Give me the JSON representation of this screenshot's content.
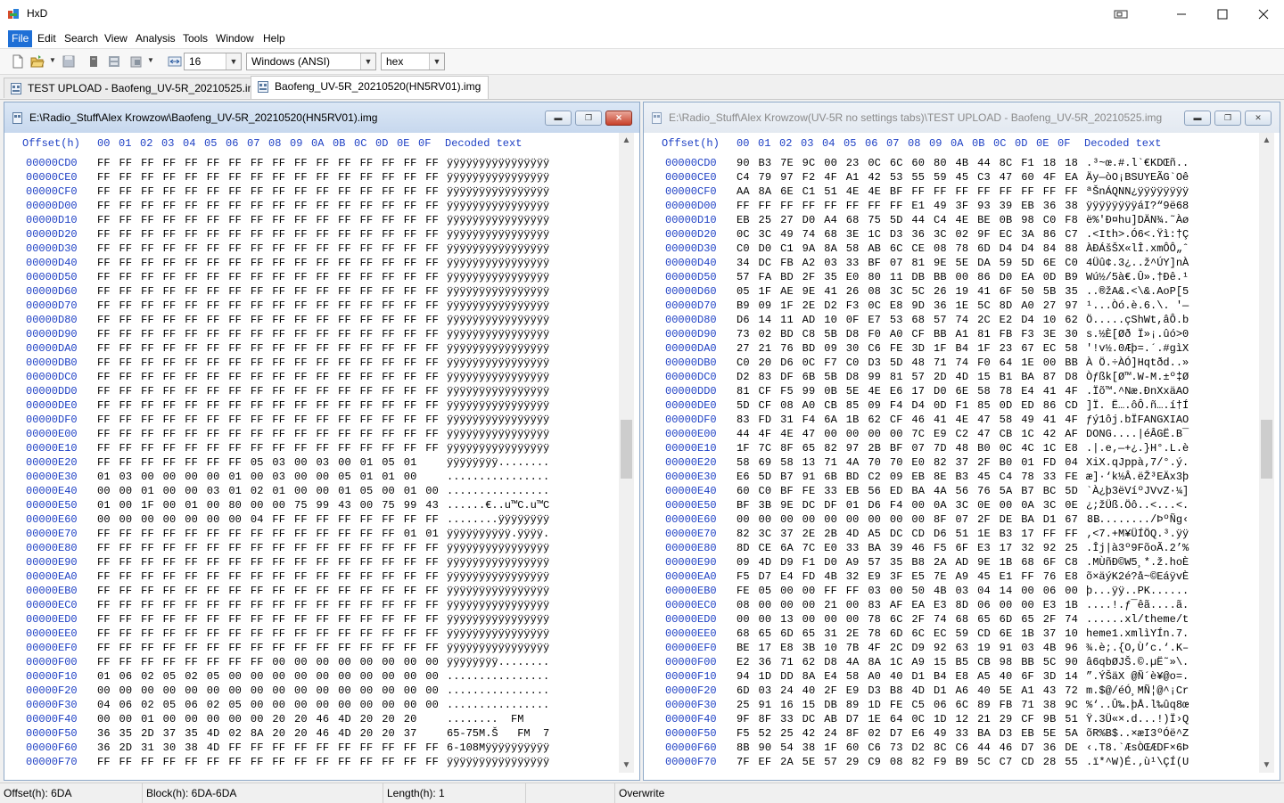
{
  "window": {
    "title": "HxD",
    "app_icon": "hxd-icon"
  },
  "menu": [
    "File",
    "Edit",
    "Search",
    "View",
    "Analysis",
    "Tools",
    "Window",
    "Help"
  ],
  "toolbar": {
    "bytes_per_row": "16",
    "charset": "Windows (ANSI)",
    "offset_base": "hex"
  },
  "tabs": [
    {
      "label": "TEST UPLOAD - Baofeng_UV-5R_20210525.img",
      "active": false
    },
    {
      "label": "Baofeng_UV-5R_20210520(HN5RV01).img",
      "active": true
    }
  ],
  "editor_header": {
    "offset_label": "Offset(h)",
    "columns": [
      "00",
      "01",
      "02",
      "03",
      "04",
      "05",
      "06",
      "07",
      "08",
      "09",
      "0A",
      "0B",
      "0C",
      "0D",
      "0E",
      "0F"
    ],
    "decoded_label": "Decoded text"
  },
  "left_pane": {
    "path": "E:\\Radio_Stuff\\Alex Krowzow\\Baofeng_UV-5R_20210520(HN5RV01).img",
    "rows": [
      {
        "o": "00000CD0",
        "h": "FF FF FF FF FF FF FF FF FF FF FF FF FF FF FF FF",
        "t": "ÿÿÿÿÿÿÿÿÿÿÿÿÿÿÿÿ"
      },
      {
        "o": "00000CE0",
        "h": "FF FF FF FF FF FF FF FF FF FF FF FF FF FF FF FF",
        "t": "ÿÿÿÿÿÿÿÿÿÿÿÿÿÿÿÿ"
      },
      {
        "o": "00000CF0",
        "h": "FF FF FF FF FF FF FF FF FF FF FF FF FF FF FF FF",
        "t": "ÿÿÿÿÿÿÿÿÿÿÿÿÿÿÿÿ"
      },
      {
        "o": "00000D00",
        "h": "FF FF FF FF FF FF FF FF FF FF FF FF FF FF FF FF",
        "t": "ÿÿÿÿÿÿÿÿÿÿÿÿÿÿÿÿ"
      },
      {
        "o": "00000D10",
        "h": "FF FF FF FF FF FF FF FF FF FF FF FF FF FF FF FF",
        "t": "ÿÿÿÿÿÿÿÿÿÿÿÿÿÿÿÿ"
      },
      {
        "o": "00000D20",
        "h": "FF FF FF FF FF FF FF FF FF FF FF FF FF FF FF FF",
        "t": "ÿÿÿÿÿÿÿÿÿÿÿÿÿÿÿÿ"
      },
      {
        "o": "00000D30",
        "h": "FF FF FF FF FF FF FF FF FF FF FF FF FF FF FF FF",
        "t": "ÿÿÿÿÿÿÿÿÿÿÿÿÿÿÿÿ"
      },
      {
        "o": "00000D40",
        "h": "FF FF FF FF FF FF FF FF FF FF FF FF FF FF FF FF",
        "t": "ÿÿÿÿÿÿÿÿÿÿÿÿÿÿÿÿ"
      },
      {
        "o": "00000D50",
        "h": "FF FF FF FF FF FF FF FF FF FF FF FF FF FF FF FF",
        "t": "ÿÿÿÿÿÿÿÿÿÿÿÿÿÿÿÿ"
      },
      {
        "o": "00000D60",
        "h": "FF FF FF FF FF FF FF FF FF FF FF FF FF FF FF FF",
        "t": "ÿÿÿÿÿÿÿÿÿÿÿÿÿÿÿÿ"
      },
      {
        "o": "00000D70",
        "h": "FF FF FF FF FF FF FF FF FF FF FF FF FF FF FF FF",
        "t": "ÿÿÿÿÿÿÿÿÿÿÿÿÿÿÿÿ"
      },
      {
        "o": "00000D80",
        "h": "FF FF FF FF FF FF FF FF FF FF FF FF FF FF FF FF",
        "t": "ÿÿÿÿÿÿÿÿÿÿÿÿÿÿÿÿ"
      },
      {
        "o": "00000D90",
        "h": "FF FF FF FF FF FF FF FF FF FF FF FF FF FF FF FF",
        "t": "ÿÿÿÿÿÿÿÿÿÿÿÿÿÿÿÿ"
      },
      {
        "o": "00000DA0",
        "h": "FF FF FF FF FF FF FF FF FF FF FF FF FF FF FF FF",
        "t": "ÿÿÿÿÿÿÿÿÿÿÿÿÿÿÿÿ"
      },
      {
        "o": "00000DB0",
        "h": "FF FF FF FF FF FF FF FF FF FF FF FF FF FF FF FF",
        "t": "ÿÿÿÿÿÿÿÿÿÿÿÿÿÿÿÿ"
      },
      {
        "o": "00000DC0",
        "h": "FF FF FF FF FF FF FF FF FF FF FF FF FF FF FF FF",
        "t": "ÿÿÿÿÿÿÿÿÿÿÿÿÿÿÿÿ"
      },
      {
        "o": "00000DD0",
        "h": "FF FF FF FF FF FF FF FF FF FF FF FF FF FF FF FF",
        "t": "ÿÿÿÿÿÿÿÿÿÿÿÿÿÿÿÿ"
      },
      {
        "o": "00000DE0",
        "h": "FF FF FF FF FF FF FF FF FF FF FF FF FF FF FF FF",
        "t": "ÿÿÿÿÿÿÿÿÿÿÿÿÿÿÿÿ"
      },
      {
        "o": "00000DF0",
        "h": "FF FF FF FF FF FF FF FF FF FF FF FF FF FF FF FF",
        "t": "ÿÿÿÿÿÿÿÿÿÿÿÿÿÿÿÿ"
      },
      {
        "o": "00000E00",
        "h": "FF FF FF FF FF FF FF FF FF FF FF FF FF FF FF FF",
        "t": "ÿÿÿÿÿÿÿÿÿÿÿÿÿÿÿÿ"
      },
      {
        "o": "00000E10",
        "h": "FF FF FF FF FF FF FF FF FF FF FF FF FF FF FF FF",
        "t": "ÿÿÿÿÿÿÿÿÿÿÿÿÿÿÿÿ"
      },
      {
        "o": "00000E20",
        "h": "FF FF FF FF FF FF FF 05 03 00 03 00 01 05 01",
        "t": "ÿÿÿÿÿÿÿÿ........"
      },
      {
        "o": "00000E30",
        "h": "01 03 00 00 00 00 01 00 03 00 00 05 01 01 00",
        "t": "................"
      },
      {
        "o": "00000E40",
        "h": "00 00 01 00 00 03 01 02 01 00 00 01 05 00 01 00",
        "t": "................"
      },
      {
        "o": "00000E50",
        "h": "01 00 1F 00 01 00 80 00 00 75 99 43 00 75 99 43",
        "t": "......€..u™C.u™C"
      },
      {
        "o": "00000E60",
        "h": "00 00 00 00 00 00 00 04 FF FF FF FF FF FF FF FF",
        "t": "........ÿÿÿÿÿÿÿÿ"
      },
      {
        "o": "00000E70",
        "h": "FF FF FF FF FF FF FF FF FF FF FF FF FF FF 01 01",
        "t": "ÿÿÿÿÿÿÿÿÿÿ.ÿÿÿÿ."
      },
      {
        "o": "00000E80",
        "h": "FF FF FF FF FF FF FF FF FF FF FF FF FF FF FF FF",
        "t": "ÿÿÿÿÿÿÿÿÿÿÿÿÿÿÿÿ"
      },
      {
        "o": "00000E90",
        "h": "FF FF FF FF FF FF FF FF FF FF FF FF FF FF FF FF",
        "t": "ÿÿÿÿÿÿÿÿÿÿÿÿÿÿÿÿ"
      },
      {
        "o": "00000EA0",
        "h": "FF FF FF FF FF FF FF FF FF FF FF FF FF FF FF FF",
        "t": "ÿÿÿÿÿÿÿÿÿÿÿÿÿÿÿÿ"
      },
      {
        "o": "00000EB0",
        "h": "FF FF FF FF FF FF FF FF FF FF FF FF FF FF FF FF",
        "t": "ÿÿÿÿÿÿÿÿÿÿÿÿÿÿÿÿ"
      },
      {
        "o": "00000EC0",
        "h": "FF FF FF FF FF FF FF FF FF FF FF FF FF FF FF FF",
        "t": "ÿÿÿÿÿÿÿÿÿÿÿÿÿÿÿÿ"
      },
      {
        "o": "00000ED0",
        "h": "FF FF FF FF FF FF FF FF FF FF FF FF FF FF FF FF",
        "t": "ÿÿÿÿÿÿÿÿÿÿÿÿÿÿÿÿ"
      },
      {
        "o": "00000EE0",
        "h": "FF FF FF FF FF FF FF FF FF FF FF FF FF FF FF FF",
        "t": "ÿÿÿÿÿÿÿÿÿÿÿÿÿÿÿÿ"
      },
      {
        "o": "00000EF0",
        "h": "FF FF FF FF FF FF FF FF FF FF FF FF FF FF FF FF",
        "t": "ÿÿÿÿÿÿÿÿÿÿÿÿÿÿÿÿ"
      },
      {
        "o": "00000F00",
        "h": "FF FF FF FF FF FF FF FF 00 00 00 00 00 00 00 00",
        "t": "ÿÿÿÿÿÿÿÿ........"
      },
      {
        "o": "00000F10",
        "h": "01 06 02 05 02 05 00 00 00 00 00 00 00 00 00 00",
        "t": "................"
      },
      {
        "o": "00000F20",
        "h": "00 00 00 00 00 00 00 00 00 00 00 00 00 00 00 00",
        "t": "................"
      },
      {
        "o": "00000F30",
        "h": "04 06 02 05 06 02 05 00 00 00 00 00 00 00 00 00",
        "t": "................"
      },
      {
        "o": "00000F40",
        "h": "00 00 01 00 00 00 00 00 20 20 46 4D 20 20 20",
        "t": "........  FM    "
      },
      {
        "o": "00000F50",
        "h": "36 35 2D 37 35 4D 02 8A 20 20 46 4D 20 20 37",
        "t": "65-75M.Š   FM  7"
      },
      {
        "o": "00000F60",
        "h": "36 2D 31 30 38 4D FF FF FF FF FF FF FF FF FF FF",
        "t": "6-108Mÿÿÿÿÿÿÿÿÿÿ"
      },
      {
        "o": "00000F70",
        "h": "FF FF FF FF FF FF FF FF FF FF FF FF FF FF FF FF",
        "t": "ÿÿÿÿÿÿÿÿÿÿÿÿÿÿÿÿ"
      }
    ]
  },
  "right_pane": {
    "path": "E:\\Radio_Stuff\\Alex Krowzow(UV-5R no settings tabs)\\TEST UPLOAD - Baofeng_UV-5R_20210525.img",
    "rows": [
      {
        "o": "00000CD0",
        "h": "90 B3 7E 9C 00 23 0C 6C 60 80 4B 44 8C F1 18 18",
        "t": ".³~œ.#.l`€KDŒñ.."
      },
      {
        "o": "00000CE0",
        "h": "C4 79 97 F2 4F A1 42 53 55 59 45 C3 47 60 4F EA",
        "t": "Äy—òO¡BSUYEÃG`Oê"
      },
      {
        "o": "00000CF0",
        "h": "AA 8A 6E C1 51 4E 4E BF FF FF FF FF FF FF FF FF",
        "t": "ªŠnÁQNN¿ÿÿÿÿÿÿÿÿ"
      },
      {
        "o": "00000D00",
        "h": "FF FF FF FF FF FF FF FF E1 49 3F 93 39 EB 36 38",
        "t": "ÿÿÿÿÿÿÿÿáI?“9ë68"
      },
      {
        "o": "00000D10",
        "h": "EB 25 27 D0 A4 68 75 5D 44 C4 4E BE 0B 98 C0 F8",
        "t": "ë%'Ð¤hu]DÄN¾.˜Àø"
      },
      {
        "o": "00000D20",
        "h": "0C 3C 49 74 68 3E 1C D3 36 3C 02 9F EC 3A 86 C7",
        "t": ".<Ith>.Ó6<.Ÿì:†Ç"
      },
      {
        "o": "00000D30",
        "h": "C0 D0 C1 9A 8A 58 AB 6C CE 08 78 6D D4 D4 84 88",
        "t": "ÀÐÁšŠX«lÎ.xmÔÔ„ˆ"
      },
      {
        "o": "00000D40",
        "h": "34 DC FB A2 03 33 BF 07 81 9E 5E DA 59 5D 6E C0",
        "t": "4Üû¢.3¿..ž^ÚY]nÀ"
      },
      {
        "o": "00000D50",
        "h": "57 FA BD 2F 35 E0 80 11 DB BB 00 86 D0 EA 0D B9",
        "t": "Wú½/5à€.Û».†Ðê.¹"
      },
      {
        "o": "00000D60",
        "h": "05 1F AE 9E 41 26 08 3C 5C 26 19 41 6F 50 5B 35",
        "t": "..®žA&.<\\&.AoP[5"
      },
      {
        "o": "00000D70",
        "h": "B9 09 1F 2E D2 F3 0C E8 9D 36 1E 5C 8D A0 27 97",
        "t": "¹...Òó.è.6.\\. '—"
      },
      {
        "o": "00000D80",
        "h": "D6 14 11 AD 10 0F E7 53 68 57 74 2C E2 D4 10 62",
        "t": "Ö.....çShWt,âÔ.b"
      },
      {
        "o": "00000D90",
        "h": "73 02 BD C8 5B D8 F0 A0 CF BB A1 81 FB F3 3E 30",
        "t": "s.½È[Øð Ï»¡.ûó>0"
      },
      {
        "o": "00000DA0",
        "h": "27 21 76 BD 09 30 C6 FE 3D 1F B4 1F 23 67 EC 58",
        "t": "'!v½.0Æþ=.´.#gìX"
      },
      {
        "o": "00000DB0",
        "h": "C0 20 D6 0C F7 C0 D3 5D 48 71 74 F0 64 1E 00 BB",
        "t": "À Ö.÷ÀÓ]Hqtðd..»"
      },
      {
        "o": "00000DC0",
        "h": "D2 83 DF 6B 5B D8 99 81 57 2D 4D 15 B1 BA 87 D8",
        "t": "Òƒßk[Ø™.W-M.±º‡Ø"
      },
      {
        "o": "00000DD0",
        "h": "81 CF F5 99 0B 5E 4E E6 17 D0 6E 58 78 E4 41 4F",
        "t": ".Ïõ™.^Næ.ÐnXxäAO"
      },
      {
        "o": "00000DE0",
        "h": "5D CF 08 A0 CB 85 09 F4 D4 0D F1 85 0D ED 86 CD",
        "t": "]Ï. Ë….ôÔ.ñ….í†Í"
      },
      {
        "o": "00000DF0",
        "h": "83 FD 31 F4 6A 1B 62 CF 46 41 4E 47 58 49 41 4F",
        "t": "ƒý1ôj.bÏFANGXIAO"
      },
      {
        "o": "00000E00",
        "h": "44 4F 4E 47 00 00 00 00 7C E9 C2 47 CB 1C 42 AF",
        "t": "DONG....|éÂGË.B¯"
      },
      {
        "o": "00000E10",
        "h": "1F 7C 8F 65 82 97 2B BF 07 7D 48 B0 0C 4C 1C E8",
        "t": ".|.e‚—+¿.}H°.L.è"
      },
      {
        "o": "00000E20",
        "h": "58 69 58 13 71 4A 70 70 E0 82 37 2F B0 01 FD 04",
        "t": "XiX.qJppà‚7/°.ý."
      },
      {
        "o": "00000E30",
        "h": "E6 5D B7 91 6B BD C2 09 EB 8E B3 45 C4 78 33 FE",
        "t": "æ]·‘k½Â.ëŽ³EÄx3þ"
      },
      {
        "o": "00000E40",
        "h": "60 C0 BF FE 33 EB 56 ED BA 4A 56 76 5A B7 BC 5D",
        "t": "`À¿þ3ëVíºJVvZ·¼]"
      },
      {
        "o": "00000E50",
        "h": "BF 3B 9E DC DF 01 D6 F4 00 0A 3C 0E 00 0A 3C 0E",
        "t": "¿;žÜß.Öô..<...<."
      },
      {
        "o": "00000E60",
        "h": "00 00 00 00 00 00 00 00 00 8F 07 2F DE BA D1 67 8B",
        "t": "........../ÞºÑg‹"
      },
      {
        "o": "00000E70",
        "h": "82 3C 37 2E 2B 4D A5 DC CD D6 51 1E B3 17 FF FF",
        "t": "‚<7.+M¥ÜÍÖQ.³.ÿÿ"
      },
      {
        "o": "00000E80",
        "h": "8D CE 6A 7C E0 33 BA 39 46 F5 6F E3 17 32 92 25",
        "t": ".Îj|à3º9FõoÃ.2’%"
      },
      {
        "o": "00000E90",
        "h": "09 4D D9 F1 D0 A9 57 35 B8 2A AD 9E 1B 68 6F C8",
        "t": ".MÙñÐ©W5¸*.ž.hoÈ"
      },
      {
        "o": "00000EA0",
        "h": "F5 D7 E4 FD 4B 32 E9 3F E5 7E A9 45 E1 FF 76 E8",
        "t": "õ×äýK2é?å~©EáÿvÈ"
      },
      {
        "o": "00000EB0",
        "h": "FE 05 00 00 FF FF 03 00 50 4B 03 04 14 00 06 00",
        "t": "þ...ÿÿ..PK......"
      },
      {
        "o": "00000EC0",
        "h": "08 00 00 00 21 00 83 AF EA E3 8D 06 00 00 E3 1B",
        "t": "....!.ƒ¯êã....ã."
      },
      {
        "o": "00000ED0",
        "h": "00 00 13 00 00 00 78 6C 2F 74 68 65 6D 65 2F 74",
        "t": "......xl/theme/t"
      },
      {
        "o": "00000EE0",
        "h": "68 65 6D 65 31 2E 78 6D 6C EC 59 CD 6E 1B 37 10",
        "t": "heme1.xmlìYÍn.7."
      },
      {
        "o": "00000EF0",
        "h": "BE 17 E8 3B 10 7B 4F 2C D9 92 63 19 91 03 4B 96",
        "t": "¾.è;.{O,Ù’c.‘.K–"
      },
      {
        "o": "00000F00",
        "h": "E2 36 71 62 D8 4A 8A 1C A9 15 B5 CB 98 BB 5C 90",
        "t": "â6qbØJŠ.©.µË˜»\\."
      },
      {
        "o": "00000F10",
        "h": "94 1D DD 8A E4 58 A0 40 D1 B4 E8 A5 40 6F 3D 14",
        "t": "”.ÝŠäX @Ñ´è¥@o=."
      },
      {
        "o": "00000F20",
        "h": "6D 03 24 40 2F E9 D3 B8 4D D1 A6 40 5E A1 43 72",
        "t": "m.$@/éÓ¸MÑ¦@^¡Cr"
      },
      {
        "o": "00000F30",
        "h": "25 91 16 15 DB 89 1D FE C5 06 6C 89 FB 71 38 9C",
        "t": "%‘..Û‰.þÅ.l‰ûq8œ"
      },
      {
        "o": "00000F40",
        "h": "9F 8F 33 DC AB D7 1E 64 0C 1D 12 21 29 CF 9B 51",
        "t": "Ÿ.3Ü«×.d...!)Ï›Q"
      },
      {
        "o": "00000F50",
        "h": "F5 52 25 42 24 8F 02 D7 E6 49 33 BA D3 EB 5E 5A",
        "t": "õR%B$..×æI3ºÓë^Z"
      },
      {
        "o": "00000F60",
        "h": "8B 90 54 38 1F 60 C6 73 D2 8C C6 44 46 D7 36 DE",
        "t": "‹.T8.`ÆsÒŒÆDF×6Þ"
      },
      {
        "o": "00000F70",
        "h": "7F EF 2A 5E 57 29 C9 08 82 F9 B9 5C C7 CD 28 55",
        "t": ".ï*^W)É.‚ù¹\\ÇÍ(U"
      }
    ]
  },
  "status": {
    "offset": "Offset(h): 6DA",
    "block": "Block(h): 6DA-6DA",
    "length": "Length(h): 1",
    "mode": "Overwrite"
  },
  "colors": {
    "offset_blue": "#1d3fc4",
    "menu_highlight": "#1e6fd6",
    "close_red": "#c8412b"
  }
}
